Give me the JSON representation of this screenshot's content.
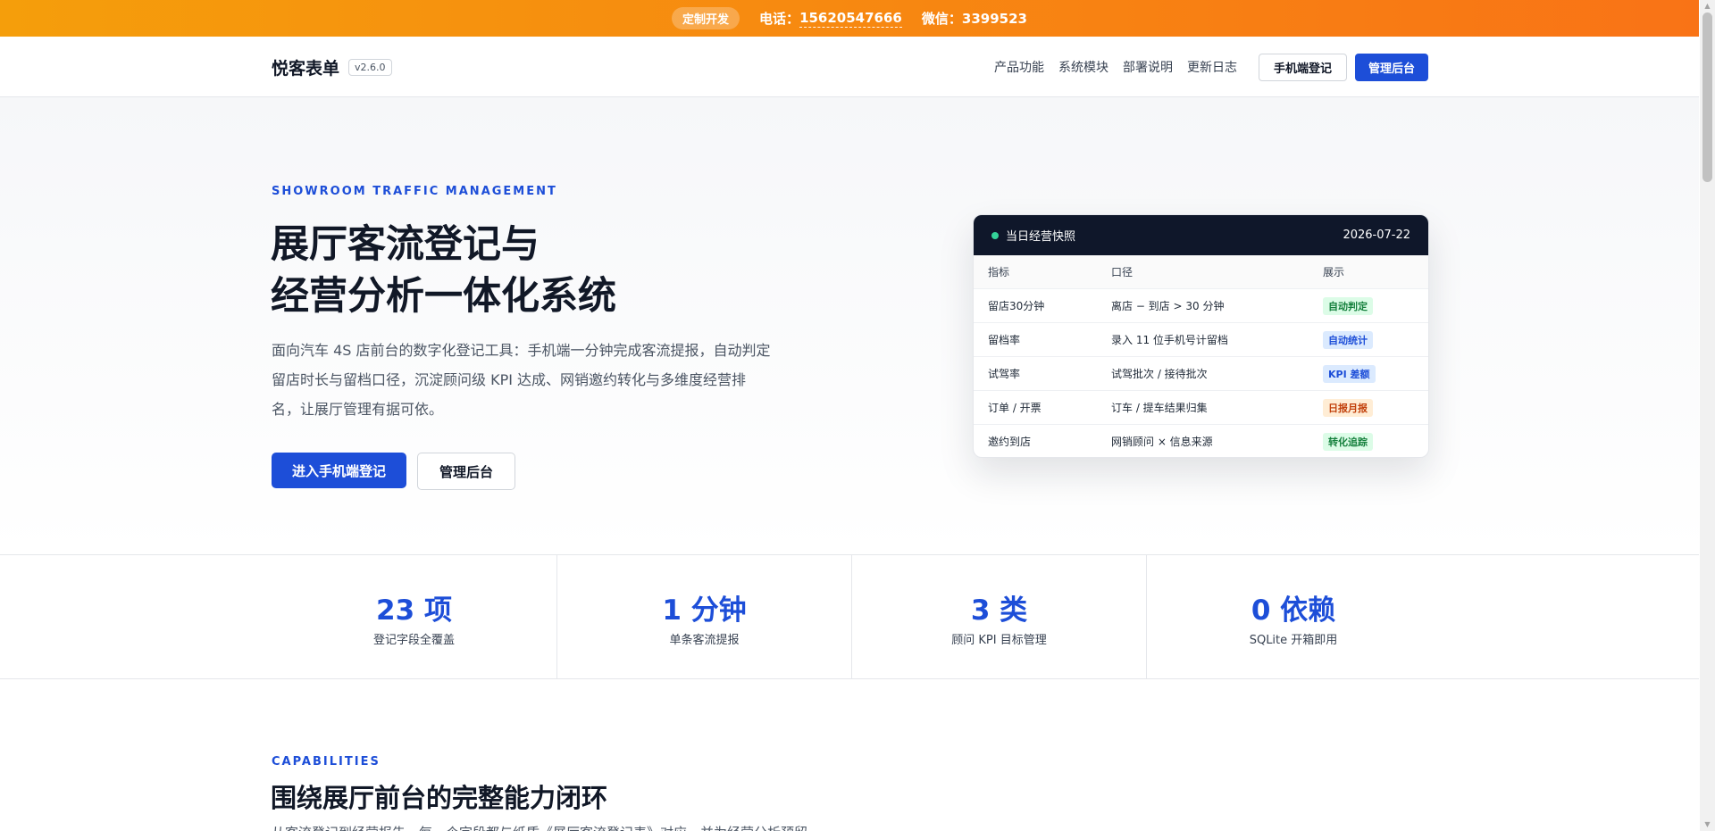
{
  "topbar": {
    "badge": "定制开发",
    "phone_label": "电话：",
    "phone_value": "15620547666",
    "wechat_label": "微信：",
    "wechat_value": "3399523"
  },
  "nav": {
    "brand": "悦客表单",
    "version": "v2.6.0",
    "links": [
      "产品功能",
      "系统模块",
      "部署说明",
      "更新日志"
    ],
    "mobile_button": "手机端登记",
    "admin_button": "管理后台"
  },
  "hero": {
    "eyebrow": "SHOWROOM TRAFFIC MANAGEMENT",
    "title_line1": "展厅客流登记与",
    "title_line2": "经营分析一体化系统",
    "description": "面向汽车 4S 店前台的数字化登记工具：手机端一分钟完成客流提报，自动判定留店时长与留档口径，沉淀顾问级 KPI 达成、网销邀约转化与多维度经营排名，让展厅管理有据可依。",
    "primary_button": "进入手机端登记",
    "secondary_button": "管理后台"
  },
  "snapshot": {
    "title": "当日经营快照",
    "date": "2026-07-22",
    "columns": [
      "指标",
      "口径",
      "展示"
    ],
    "rows": [
      {
        "metric": "留店30分钟",
        "rule": "离店 − 到店 > 30 分钟",
        "display": "自动判定",
        "color": "green"
      },
      {
        "metric": "留档率",
        "rule": "录入 11 位手机号计留档",
        "display": "自动统计",
        "color": "blue"
      },
      {
        "metric": "试驾率",
        "rule": "试驾批次 / 接待批次",
        "display": "KPI 差额",
        "color": "blue"
      },
      {
        "metric": "订单 / 开票",
        "rule": "订车 / 提车结果归集",
        "display": "日报月报",
        "color": "orange"
      },
      {
        "metric": "邀约到店",
        "rule": "网销顾问 × 信息来源",
        "display": "转化追踪",
        "color": "green"
      }
    ]
  },
  "stats": [
    {
      "value": "23 项",
      "label": "登记字段全覆盖"
    },
    {
      "value": "1 分钟",
      "label": "单条客流提报"
    },
    {
      "value": "3 类",
      "label": "顾问 KPI 目标管理"
    },
    {
      "value": "0 依赖",
      "label": "SQLite 开箱即用"
    }
  ],
  "capabilities": {
    "eyebrow": "CAPABILITIES",
    "title": "围绕展厅前台的完整能力闭环",
    "description": "从客流登记到经营报告，每一个字段都与纸质《展厅客流登记表》对应，并为经营分析预留。"
  },
  "colors": {
    "accent": "#1d4ed8",
    "topbar_start": "#f59e0b",
    "topbar_end": "#f97316",
    "card_header": "#0f172a"
  }
}
